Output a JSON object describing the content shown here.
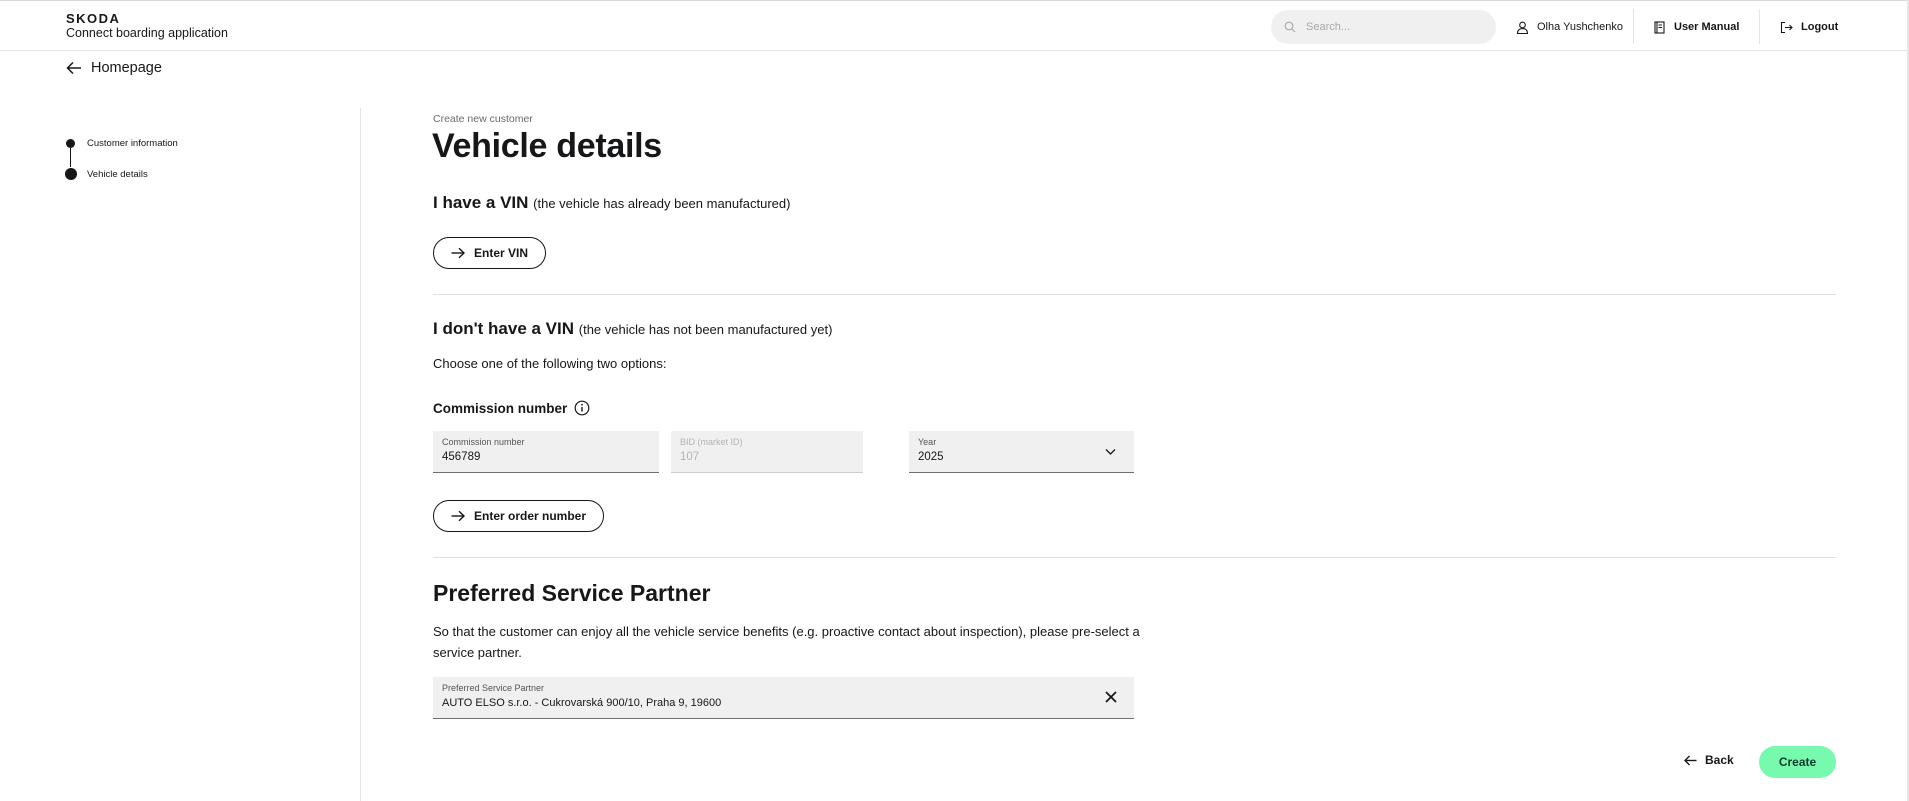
{
  "header": {
    "brand_logo": "SKODA",
    "app_name": "Connect boarding application",
    "search_placeholder": "Search...",
    "user_name": "Olha Yushchenko",
    "manual_label": "User Manual",
    "logout_label": "Logout"
  },
  "nav": {
    "home_label": "Homepage"
  },
  "stepper": {
    "steps": [
      {
        "label": "Customer information"
      },
      {
        "label": "Vehicle details"
      }
    ]
  },
  "main": {
    "breadcrumb": "Create new customer",
    "title": "Vehicle details",
    "vin_section": {
      "heading": "I have a VIN",
      "subheading": "(the vehicle has already been manufactured)",
      "button_label": "Enter VIN"
    },
    "novin_section": {
      "heading": "I don't have a VIN",
      "subheading": "(the vehicle has not been manufactured yet)",
      "instruction": "Choose one of the following two options:",
      "commission_heading": "Commission number",
      "commission_field": {
        "label": "Commission number",
        "value": "456789"
      },
      "bid_field": {
        "label": "BID (market ID)",
        "value": "107"
      },
      "year_field": {
        "label": "Year",
        "value": "2025"
      },
      "order_button_label": "Enter order number"
    },
    "service_partner": {
      "heading": "Preferred Service Partner",
      "description": "So that the customer can enjoy all the vehicle service benefits (e.g. proactive contact about inspection), please pre-select a service partner.",
      "field_label": "Preferred Service Partner",
      "field_value": "AUTO ELSO  s.r.o. - Cukrovarská 900/10, Praha 9, 19600"
    }
  },
  "footer": {
    "back_label": "Back",
    "create_label": "Create"
  },
  "colors": {
    "create_button": "#78faae",
    "text": "#161718",
    "field_bg": "#f0f0f0"
  }
}
